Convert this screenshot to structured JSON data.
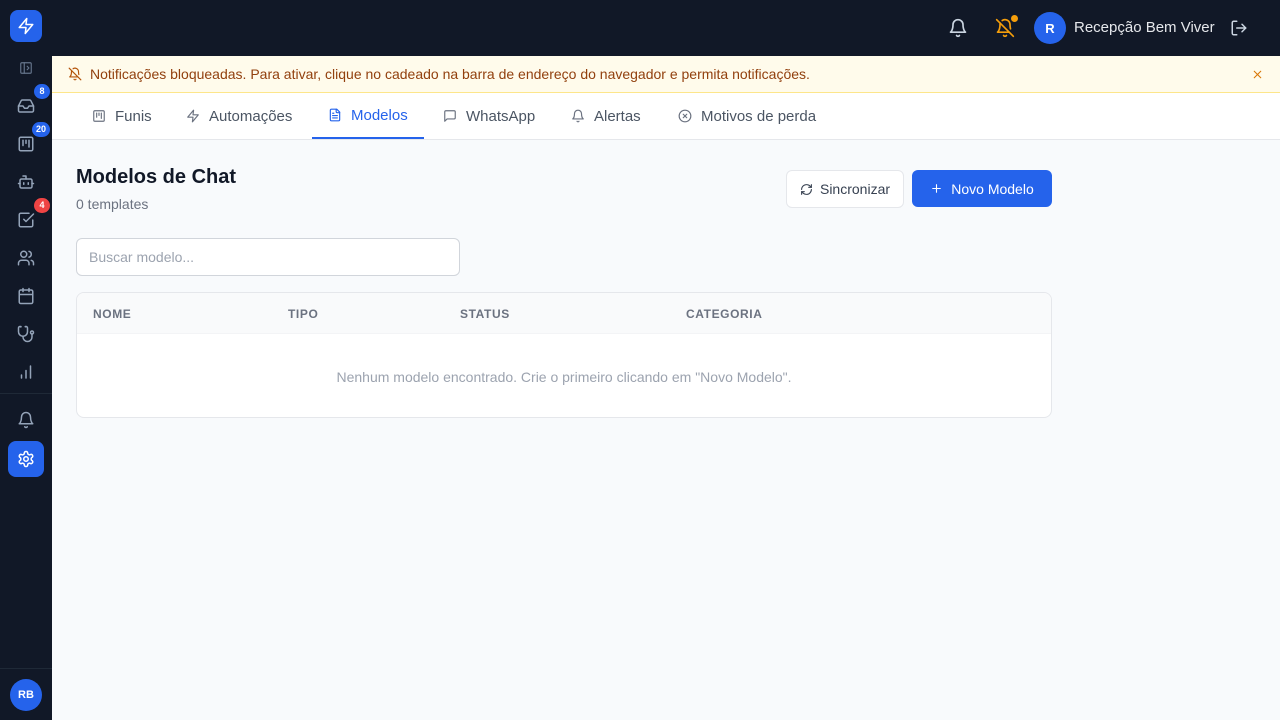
{
  "app": {
    "user_initial": "R",
    "user_name": "Recepção Bem Viver",
    "sidebar_avatar": "RB"
  },
  "sidebar": {
    "items": [
      {
        "name": "inbox",
        "icon": "inbox-icon",
        "badge": "8"
      },
      {
        "name": "pipeline",
        "icon": "kanban-icon",
        "badge": "20"
      },
      {
        "name": "bots",
        "icon": "bot-icon",
        "badge": ""
      },
      {
        "name": "tasks",
        "icon": "checkbox-icon",
        "badge": "4"
      },
      {
        "name": "contacts",
        "icon": "users-icon",
        "badge": ""
      },
      {
        "name": "calendar",
        "icon": "calendar-icon",
        "badge": ""
      },
      {
        "name": "clinical",
        "icon": "stethoscope-icon",
        "badge": ""
      },
      {
        "name": "reports",
        "icon": "bar-chart-icon",
        "badge": ""
      },
      {
        "name": "notifications",
        "icon": "bell-icon",
        "badge": ""
      },
      {
        "name": "settings",
        "icon": "gear-icon",
        "badge": "",
        "active": true
      }
    ]
  },
  "banner": {
    "text": "Notificações bloqueadas. Para ativar, clique no cadeado na barra de endereço do navegador e permita notificações."
  },
  "tabs": [
    {
      "label": "Funis",
      "icon": "kanban-icon"
    },
    {
      "label": "Automações",
      "icon": "zap-icon"
    },
    {
      "label": "Modelos",
      "icon": "file-text-icon",
      "active": true
    },
    {
      "label": "WhatsApp",
      "icon": "message-icon"
    },
    {
      "label": "Alertas",
      "icon": "bell-icon"
    },
    {
      "label": "Motivos de perda",
      "icon": "x-circle-icon"
    }
  ],
  "main": {
    "title": "Modelos de Chat",
    "subtitle": "0 templates",
    "sync_label": "Sincronizar",
    "new_label": "Novo Modelo",
    "search_placeholder": "Buscar modelo..."
  },
  "table": {
    "headers": [
      "NOME",
      "TIPO",
      "STATUS",
      "CATEGORIA"
    ],
    "empty_text": "Nenhum modelo encontrado. Crie o primeiro clicando em \"Novo Modelo\"."
  },
  "colors": {
    "primary": "#2563eb",
    "sidebar_bg": "#111827",
    "badge_red": "#ef4444",
    "warning_bg": "#fffbeb",
    "warning_text": "#92400e",
    "notification_dot": "#f59e0b"
  }
}
